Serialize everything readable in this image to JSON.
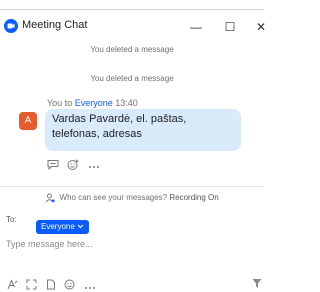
{
  "window": {
    "title": "Meeting Chat",
    "min_glyph": "—",
    "max_glyph": "☐",
    "close_glyph": "✕"
  },
  "system_messages": [
    "You deleted a message",
    "You deleted a message"
  ],
  "message": {
    "sender_prefix": "You to ",
    "recipient": "Everyone",
    "time": "13:40",
    "avatar_initial": "A",
    "avatar_color": "#e8592c",
    "text": "Vardas Pavardė, el. paštas, telefonas, adresas",
    "actions": [
      "reply-thread-icon",
      "add-reaction-icon",
      "more-icon"
    ]
  },
  "visibility": {
    "question": "Who can see your messages?",
    "status": "Recording On"
  },
  "composer": {
    "to_label": "To:",
    "recipient": "Everyone",
    "placeholder": "Type message here...",
    "tools": [
      "format-icon",
      "screenshot-icon",
      "file-icon",
      "emoji-icon",
      "more-icon"
    ],
    "send_icon": "send-icon"
  },
  "colors": {
    "accent": "#0b5cff",
    "bubble": "#d9ebfb",
    "muted_text": "#707070"
  }
}
